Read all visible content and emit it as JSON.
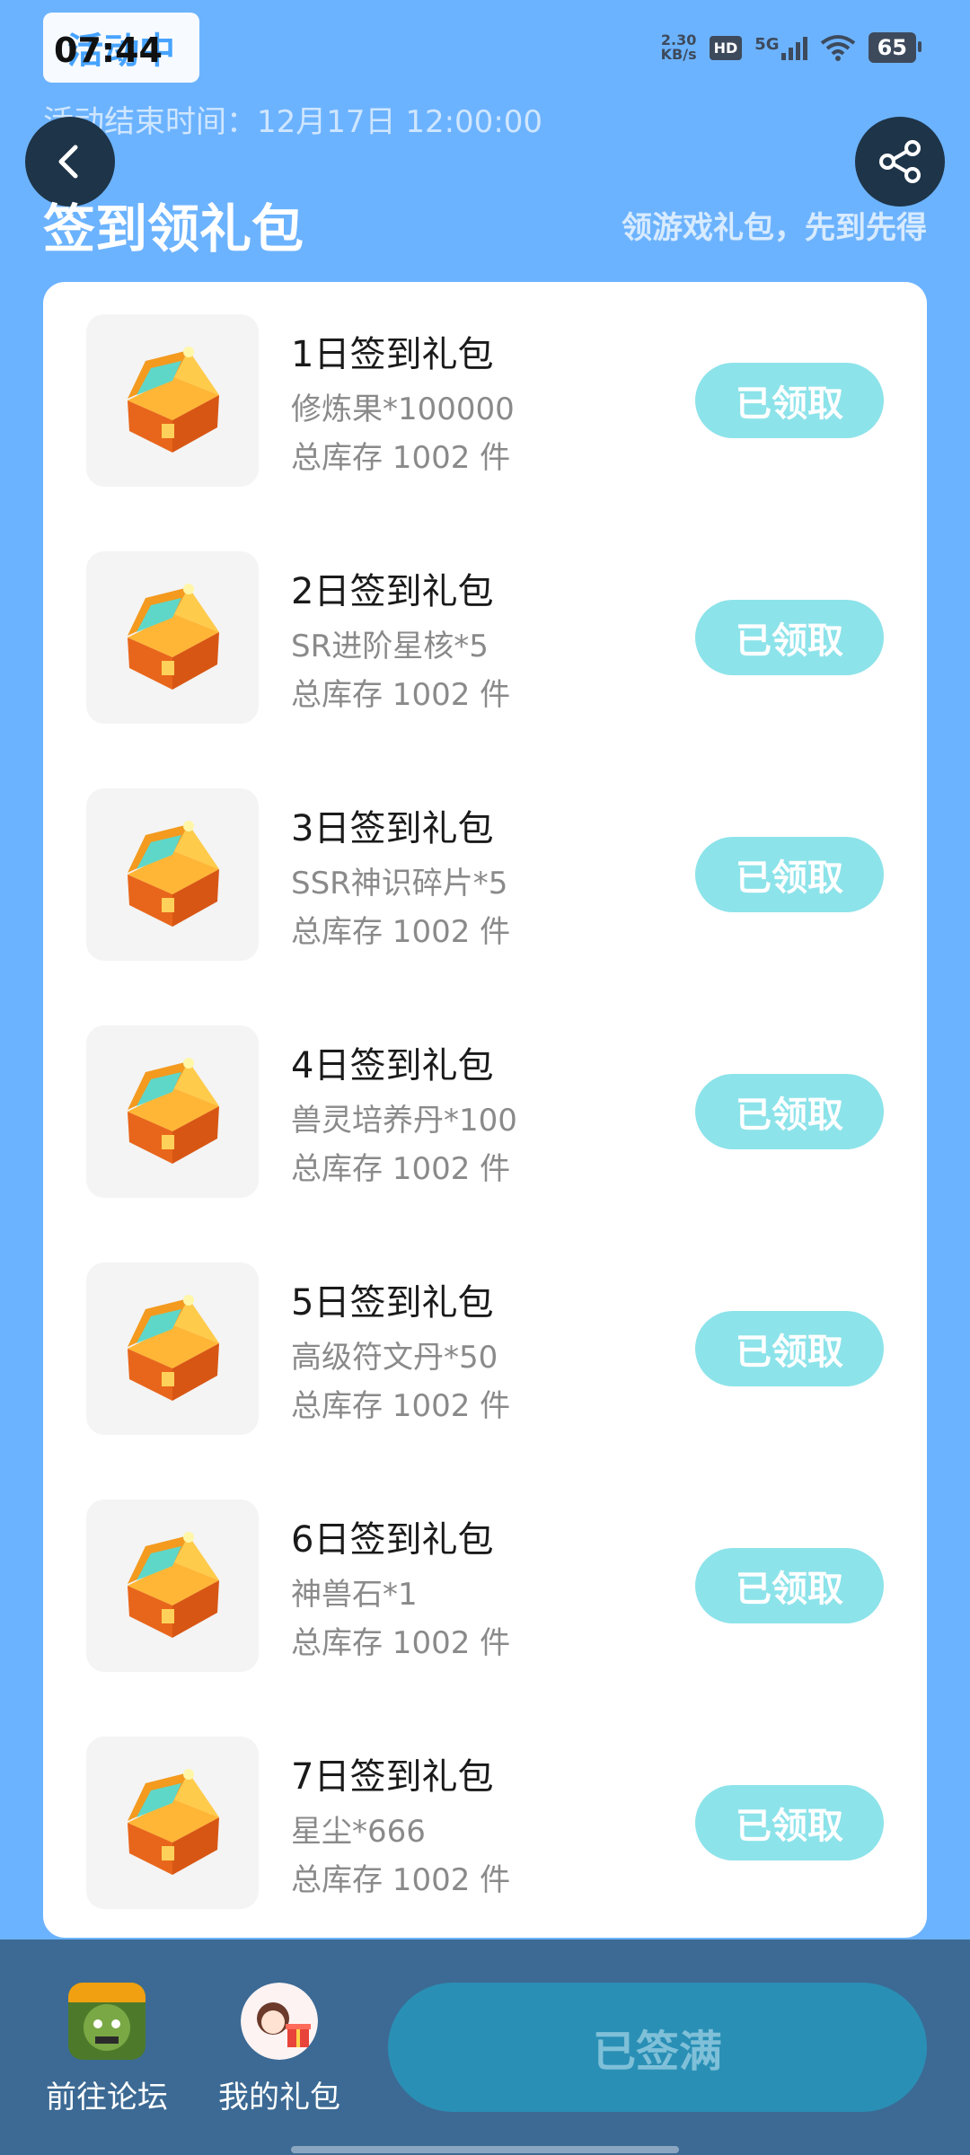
{
  "status_bar": {
    "time": "07:44",
    "net_speed_value": "2.30",
    "net_speed_unit": "KB/s",
    "hd_label": "HD",
    "network_label": "5G",
    "battery_level": "65"
  },
  "header": {
    "activity_badge": "活动中",
    "end_time": "活动结束时间：12月17日 12:00:00",
    "title": "签到领礼包",
    "subtitle": "领游戏礼包，先到先得"
  },
  "gifts": [
    {
      "name": "1日签到礼包",
      "reward": "修炼果*100000",
      "stock": "总库存 1002 件",
      "button": "已领取"
    },
    {
      "name": "2日签到礼包",
      "reward": "SR进阶星核*5",
      "stock": "总库存 1002 件",
      "button": "已领取"
    },
    {
      "name": "3日签到礼包",
      "reward": "SSR神识碎片*5",
      "stock": "总库存 1002 件",
      "button": "已领取"
    },
    {
      "name": "4日签到礼包",
      "reward": "兽灵培养丹*100",
      "stock": "总库存 1002 件",
      "button": "已领取"
    },
    {
      "name": "5日签到礼包",
      "reward": "高级符文丹*50",
      "stock": "总库存 1002 件",
      "button": "已领取"
    },
    {
      "name": "6日签到礼包",
      "reward": "神兽石*1",
      "stock": "总库存 1002 件",
      "button": "已领取"
    },
    {
      "name": "7日签到礼包",
      "reward": "星尘*666",
      "stock": "总库存 1002 件",
      "button": "已领取"
    }
  ],
  "bottom": {
    "forum_label": "前往论坛",
    "my_gifts_label": "我的礼包",
    "signed_label": "已签满"
  },
  "colors": {
    "background": "#6cb3ff",
    "claim_button": "#8de3ea",
    "bottom_bar": "#3c6a94",
    "signed_button": "#2a8fb5"
  }
}
